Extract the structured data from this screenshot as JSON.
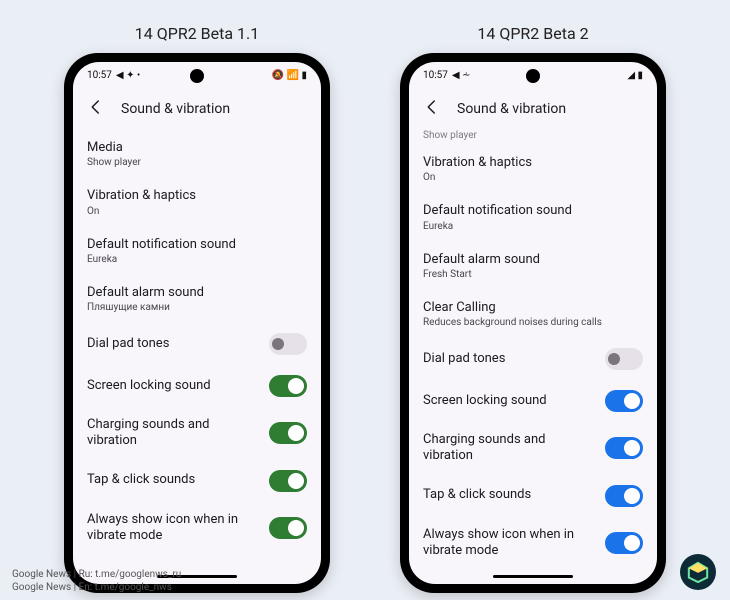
{
  "credits": {
    "line1": "Google News | Ru: t.me/googlenws_ru",
    "line2": "Google News | En: t.me/google_nws"
  },
  "phones": [
    {
      "title": "14 QPR2 Beta 1.1",
      "accent": "green",
      "status": {
        "time": "10:57",
        "left_icons": "◀ ✦ •",
        "right_icons": "🔕 📶 ▮"
      },
      "header": "Sound & vibration",
      "partial_top": "",
      "rows": [
        {
          "label": "Media",
          "sub": "Show player",
          "type": "nav"
        },
        {
          "label": "Vibration & haptics",
          "sub": "On",
          "type": "nav"
        },
        {
          "label": "Default notification sound",
          "sub": "Eureka",
          "type": "nav"
        },
        {
          "label": "Default alarm sound",
          "sub": "Пляшущие камни",
          "type": "nav"
        },
        {
          "label": "Dial pad tones",
          "type": "toggle",
          "on": false
        },
        {
          "label": "Screen locking sound",
          "type": "toggle",
          "on": true
        },
        {
          "label": "Charging sounds and vibration",
          "type": "toggle",
          "on": true
        },
        {
          "label": "Tap & click sounds",
          "type": "toggle",
          "on": true
        },
        {
          "label": "Always show icon when in vibrate mode",
          "type": "toggle",
          "on": true
        }
      ]
    },
    {
      "title": "14 QPR2 Beta 2",
      "accent": "blue",
      "status": {
        "time": "10:57",
        "left_icons": "◀ ⩪",
        "right_icons": "◢ ▮"
      },
      "header": "Sound & vibration",
      "partial_top": "Show player",
      "rows": [
        {
          "label": "Vibration & haptics",
          "sub": "On",
          "type": "nav"
        },
        {
          "label": "Default notification sound",
          "sub": "Eureka",
          "type": "nav"
        },
        {
          "label": "Default alarm sound",
          "sub": "Fresh Start",
          "type": "nav"
        },
        {
          "label": "Clear Calling",
          "sub": "Reduces background noises during calls",
          "type": "nav"
        },
        {
          "label": "Dial pad tones",
          "type": "toggle",
          "on": false
        },
        {
          "label": "Screen locking sound",
          "type": "toggle",
          "on": true
        },
        {
          "label": "Charging sounds and vibration",
          "type": "toggle",
          "on": true
        },
        {
          "label": "Tap & click sounds",
          "type": "toggle",
          "on": true
        },
        {
          "label": "Always show icon when in vibrate mode",
          "type": "toggle",
          "on": true
        }
      ]
    }
  ]
}
